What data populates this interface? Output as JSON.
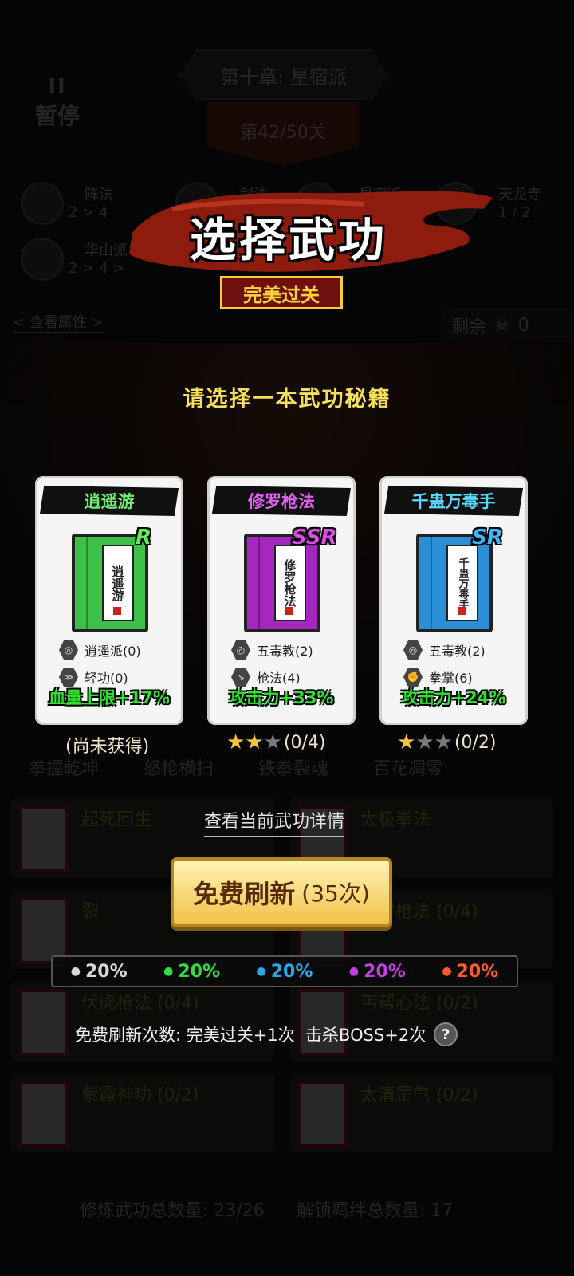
{
  "background": {
    "pause_label": "暂停",
    "pause_bars": "II",
    "chapter": "第十章: 星宿派",
    "stage": "第42/50关",
    "factions": [
      {
        "name": "阵法",
        "progress": "2 > 4"
      },
      {
        "name": "剑法",
        "progress": ""
      },
      {
        "name": "星宿派",
        "progress": ""
      },
      {
        "name": "天龙寺",
        "progress": "1 / 2"
      },
      {
        "name": "华山派",
        "progress": "2 > 4 >"
      }
    ],
    "view_attributes": "< 查看属性 >",
    "remaining_label": "剩余",
    "remaining_value": "0",
    "skill_tree_labels": [
      "拳握乾坤",
      "怒枪横扫",
      "铁拳裂魂",
      "百花凋零"
    ],
    "slots": [
      "起死回生",
      "太极拳法",
      "裂",
      "修罗枪法 (0/4)",
      "伏虎枪法 (0/4)",
      "丐帮心法 (0/2)",
      "紫霞神功 (0/2)",
      "太清罡气 (0/2)"
    ],
    "total_learned_label": "修炼武功总数量:",
    "total_learned_value": "23/26",
    "total_bond_label": "解锁羁绊总数量:",
    "total_bond_value": "17"
  },
  "overlay": {
    "title": "选择武功",
    "perfect_badge": "完美过关",
    "prompt": "请选择一本武功秘籍",
    "cards": [
      {
        "name": "逍遥游",
        "name_color": "#6ef06e",
        "rarity": "R",
        "rarity_color": "#5cf05c",
        "book_color": "#3cc04a",
        "book_text": "逍遥游",
        "attr1": "逍遥派(0)",
        "attr2": "轻功(0)",
        "bonus": "血量上限+17%",
        "status_text": "(尚未获得)",
        "stars_filled": 0,
        "stars_total": 0
      },
      {
        "name": "修罗枪法",
        "name_color": "#e060f0",
        "rarity": "SSR",
        "rarity_color": "#d84ce8",
        "book_color": "#a428c0",
        "book_text": "修罗枪法",
        "attr1": "五毒教(2)",
        "attr2": "枪法(4)",
        "bonus": "攻击力+33%",
        "status_text": "(0/4)",
        "stars_filled": 2,
        "stars_total": 3
      },
      {
        "name": "千蛊万毒手",
        "name_color": "#5ad8ff",
        "rarity": "SR",
        "rarity_color": "#3ab8ff",
        "book_color": "#2b8fd8",
        "book_text": "千蛊万毒手",
        "attr1": "五毒教(2)",
        "attr2": "拳掌(6)",
        "bonus": "攻击力+24%",
        "status_text": "(0/2)",
        "stars_filled": 1,
        "stars_total": 3
      }
    ],
    "detail_link": "查看当前武功详情",
    "refresh_label": "免费刷新",
    "refresh_count": "(35次)",
    "probabilities": [
      {
        "value": "20%",
        "color": "#d8d8d8"
      },
      {
        "value": "20%",
        "color": "#33dd44"
      },
      {
        "value": "20%",
        "color": "#2aa8e8"
      },
      {
        "value": "20%",
        "color": "#c040e0"
      },
      {
        "value": "20%",
        "color": "#ff5a2a"
      }
    ],
    "free_info": "免费刷新次数: 完美过关+1次  击杀BOSS+2次",
    "help_icon": "?"
  }
}
